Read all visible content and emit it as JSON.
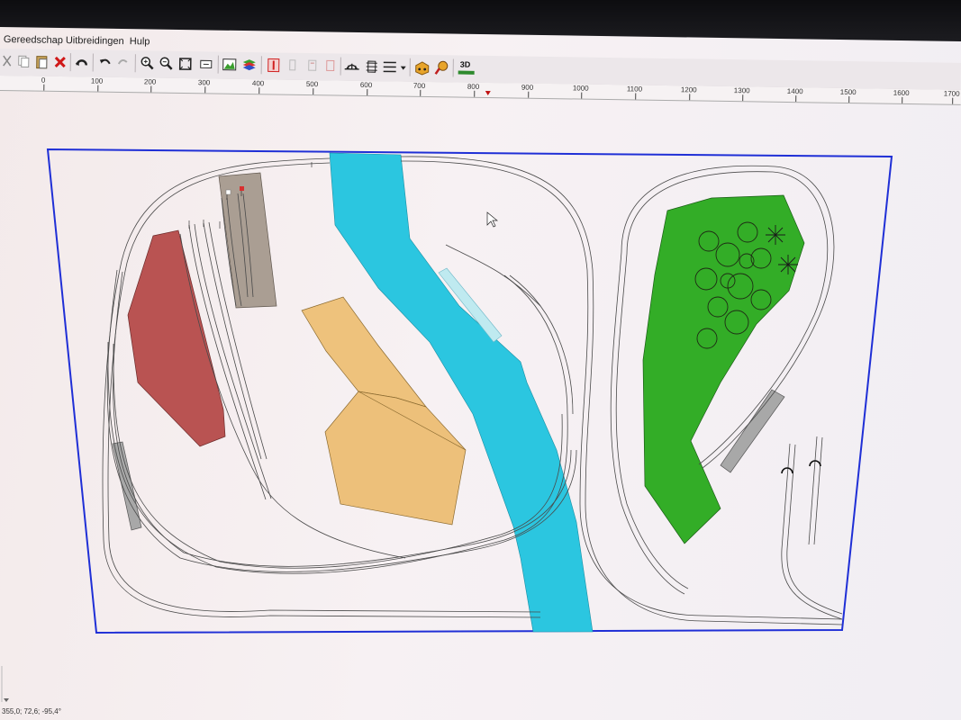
{
  "menu": {
    "gereedschap": "Gereedschap",
    "uitbreidingen": "Uitbreidingen",
    "hulp": "Hulp"
  },
  "toolbar": {
    "view3d_label": "3D"
  },
  "ruler": {
    "ticks": [
      "0",
      "100",
      "200",
      "300",
      "400",
      "500",
      "600",
      "700",
      "800",
      "900",
      "1000",
      "1100",
      "1200",
      "1300",
      "1400",
      "1500",
      "1600",
      "1700"
    ]
  },
  "status": {
    "coordinates": "355,0; 72,6; -95,4°"
  },
  "colors": {
    "border": "#1f2fd6",
    "river": "#2bc6e0",
    "brick": "#b95352",
    "sand": "#eec27c",
    "grass": "#33ad27",
    "shed": "#aa9e93",
    "platform": "#a8a8a8",
    "water_light": "#bfeaf0"
  }
}
